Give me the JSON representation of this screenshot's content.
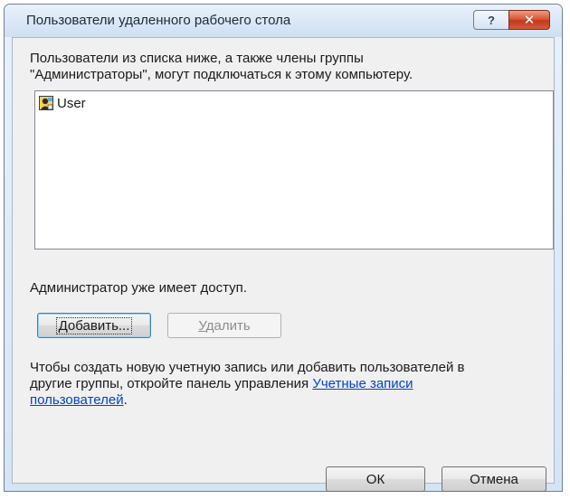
{
  "window": {
    "title": "Пользователи удаленного рабочего стола",
    "help_symbol": "?",
    "close_symbol": "✕"
  },
  "description": {
    "line1": "Пользователи из списка ниже, а также члены группы",
    "line2": "\"Администраторы\", могут подключаться к этому компьютеру."
  },
  "users_list": {
    "items": [
      {
        "icon": "user-icon",
        "label": "User"
      }
    ]
  },
  "admin_note": "Администратор уже имеет доступ.",
  "buttons": {
    "add": {
      "mnemonic": "Д",
      "rest": "обавить..."
    },
    "remove": {
      "mnemonic": "У",
      "rest": "далить"
    },
    "ok": "ОК",
    "cancel": "Отмена"
  },
  "info": {
    "line1": "Чтобы создать новую учетную запись или добавить пользователей в",
    "line2_prefix": "другие группы, откройте панель управления ",
    "link_part1": "Учетные записи",
    "link_part2": "пользователей",
    "suffix": "."
  }
}
